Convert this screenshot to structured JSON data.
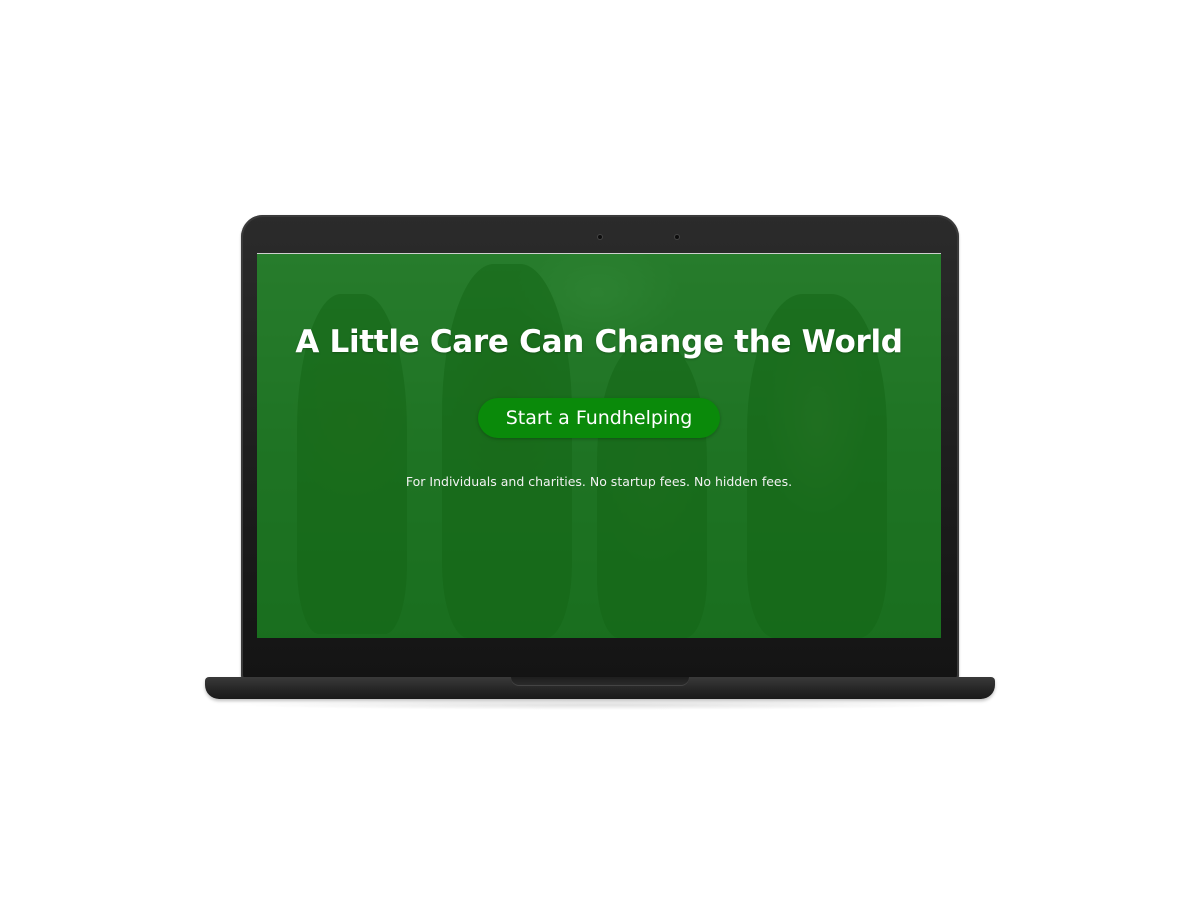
{
  "hero": {
    "title": "A Little Care Can Change the World",
    "cta_label": "Start a Fundhelping",
    "tagline": "For Individuals and charities. No startup fees. No hidden fees."
  },
  "colors": {
    "overlay_green": "#0c8214",
    "button_green": "#0a8a0a",
    "text": "#ffffff",
    "device_body": "#1c1c1c"
  },
  "icons": [
    "camera-icon",
    "camera-icon"
  ]
}
